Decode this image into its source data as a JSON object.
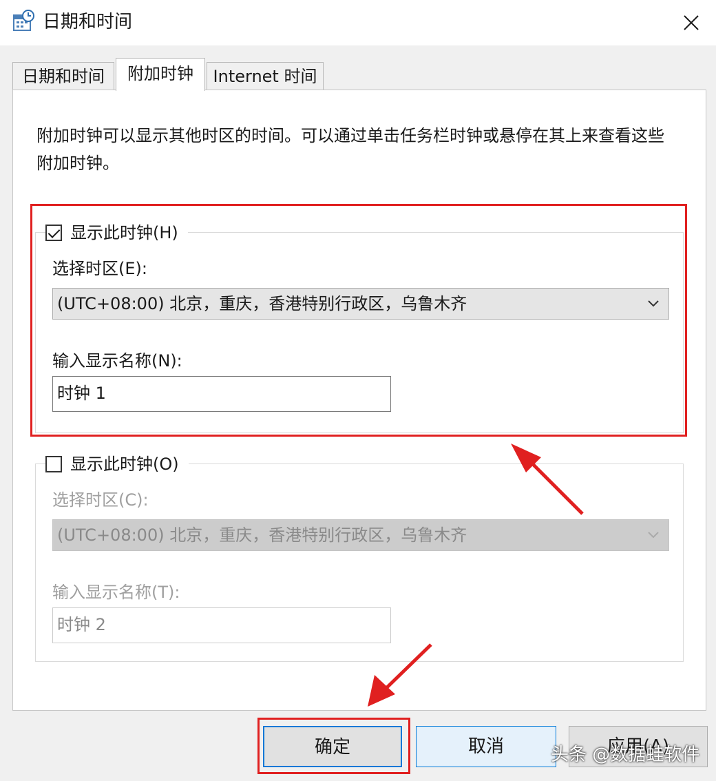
{
  "window": {
    "title": "日期和时间"
  },
  "tabs": [
    {
      "label": "日期和时间"
    },
    {
      "label": "附加时钟"
    },
    {
      "label": "Internet 时间"
    }
  ],
  "description": "附加时钟可以显示其他时区的时间。可以通过单击任务栏时钟或悬停在其上来查看这些附加时钟。",
  "clock1": {
    "checked": true,
    "show_label": "显示此时钟(H)",
    "tz_label": "选择时区(E):",
    "tz_value": "(UTC+08:00) 北京，重庆，香港特别行政区，乌鲁木齐",
    "name_label": "输入显示名称(N):",
    "name_value": "时钟 1"
  },
  "clock2": {
    "checked": false,
    "show_label": "显示此时钟(O)",
    "tz_label": "选择时区(C):",
    "tz_value": "(UTC+08:00) 北京，重庆，香港特别行政区，乌鲁木齐",
    "name_label": "输入显示名称(T):",
    "name_value": "时钟 2"
  },
  "buttons": {
    "ok": "确定",
    "cancel": "取消",
    "apply": "应用(A)"
  },
  "watermark": "头条 @数据蛙软件",
  "colors": {
    "annotation": "#e02020",
    "focus": "#0078d7"
  }
}
